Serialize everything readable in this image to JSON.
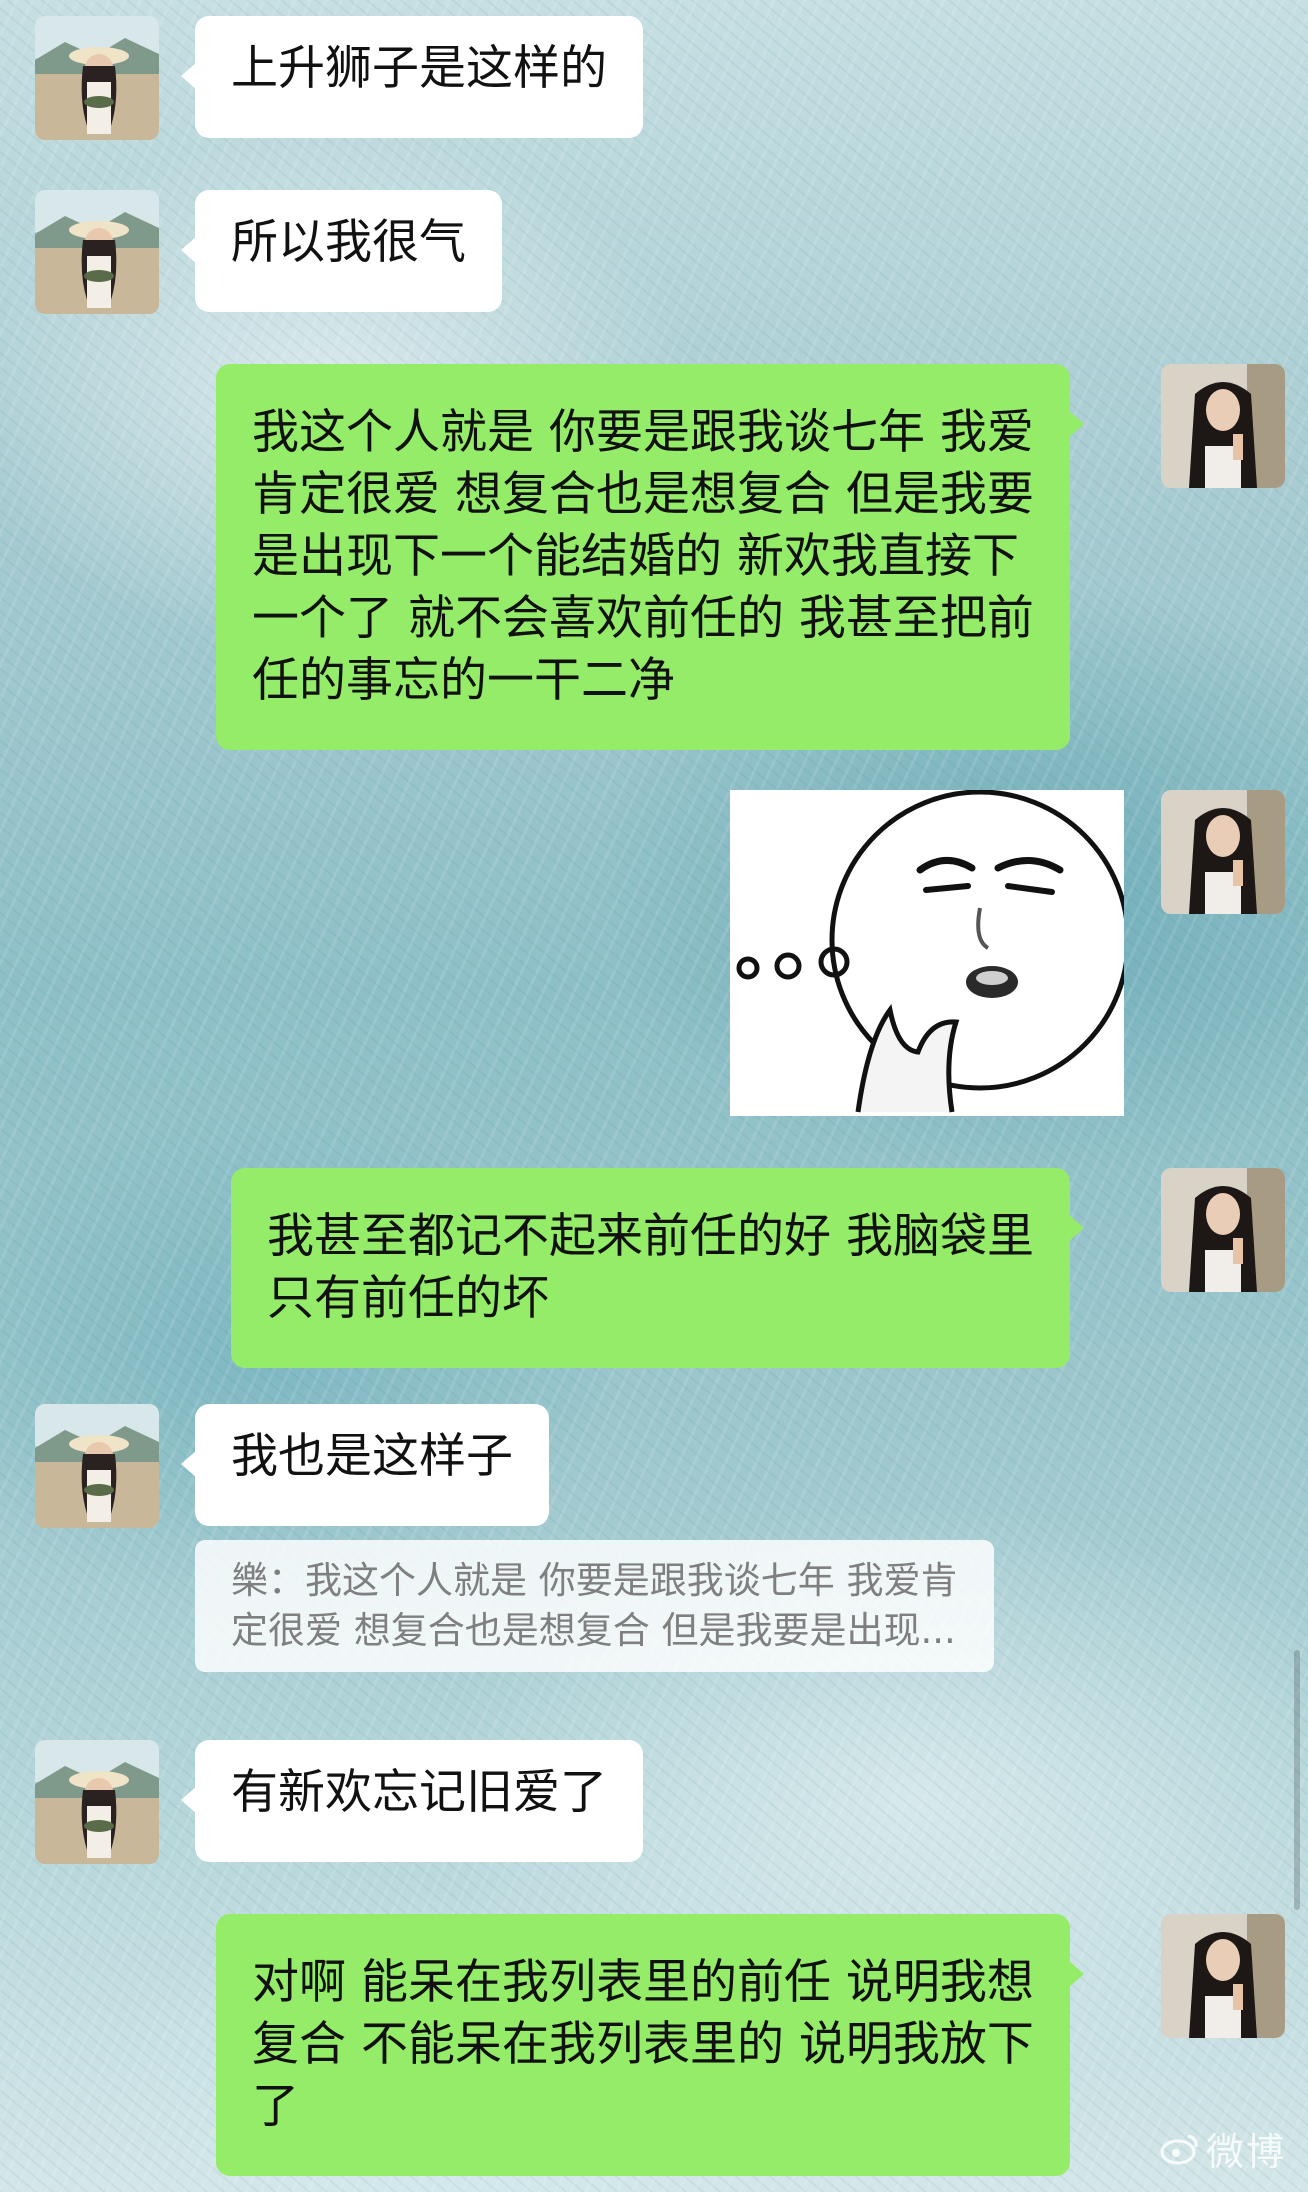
{
  "messages": [
    {
      "side": "in",
      "lines": [
        "上升狮子是这样的"
      ]
    },
    {
      "side": "in",
      "lines": [
        "所以我很气"
      ]
    },
    {
      "side": "out",
      "lines": [
        "我这个人就是 你要是跟我谈七年 我爱",
        "肯定很爱 想复合也是想复合 但是我要",
        "是出现下一个能结婚的 新欢我直接下",
        "一个了 就不会喜欢前任的 我甚至把前",
        "任的事忘的一干二净"
      ]
    },
    {
      "side": "out",
      "sticker": "thinking-face-sticker"
    },
    {
      "side": "out",
      "lines": [
        "我甚至都记不起来前任的好 我脑袋里",
        "只有前任的坏"
      ]
    },
    {
      "side": "in",
      "lines": [
        "我也是这样子"
      ]
    },
    {
      "side": "quote",
      "lines": [
        "樂：我这个人就是 你要是跟我谈七年 我爱肯",
        "定很爱 想复合也是想复合 但是我要是出现..."
      ]
    },
    {
      "side": "in",
      "lines": [
        "有新欢忘记旧爱了"
      ]
    },
    {
      "side": "out",
      "lines": [
        "对啊 能呆在我列表里的前任 说明我想",
        "复合 不能呆在我列表里的 说明我放下",
        "了"
      ]
    }
  ],
  "watermark": "微博",
  "colors": {
    "outgoing_bubble": "#95ec69",
    "incoming_bubble": "#ffffff",
    "quote_text": "#7f7f7f"
  },
  "icons": {
    "incoming_avatar": "avatar-woman-hat-icon",
    "outgoing_avatar": "avatar-woman-long-hair-icon"
  }
}
